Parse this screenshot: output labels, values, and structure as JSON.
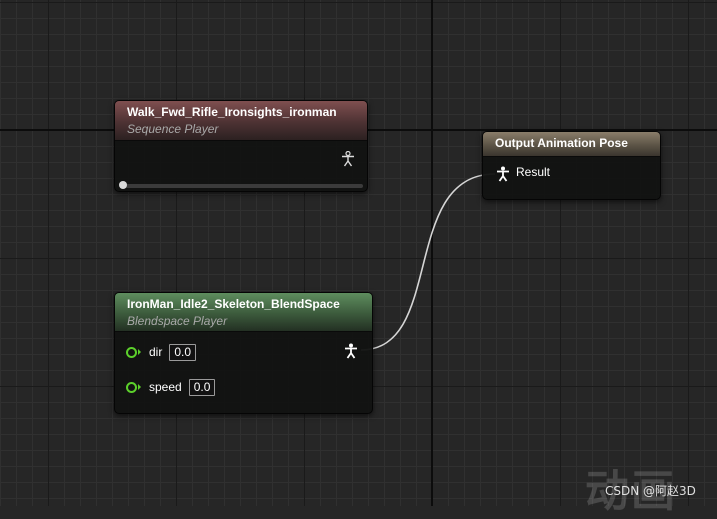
{
  "nodes": {
    "sequence_player": {
      "title": "Walk_Fwd_Rifle_Ironsights_ironman",
      "subtitle": "Sequence Player",
      "header_color": "#7f4f50"
    },
    "blendspace_player": {
      "title": "IronMan_Idle2_Skeleton_BlendSpace",
      "subtitle": "Blendspace Player",
      "header_color": "#5e8d5e",
      "pins": [
        {
          "label": "dir",
          "value": "0.0"
        },
        {
          "label": "speed",
          "value": "0.0"
        }
      ],
      "pin_color": "#5cd02b"
    },
    "output_pose": {
      "title": "Output Animation Pose",
      "header_color": "#8a7d6a",
      "pin_label": "Result"
    }
  },
  "icons": {
    "pose": "pose-pin-icon",
    "float_pin": "float-pin-icon"
  },
  "watermark": {
    "large": "动画",
    "small": "CSDN @阿赵3D"
  }
}
